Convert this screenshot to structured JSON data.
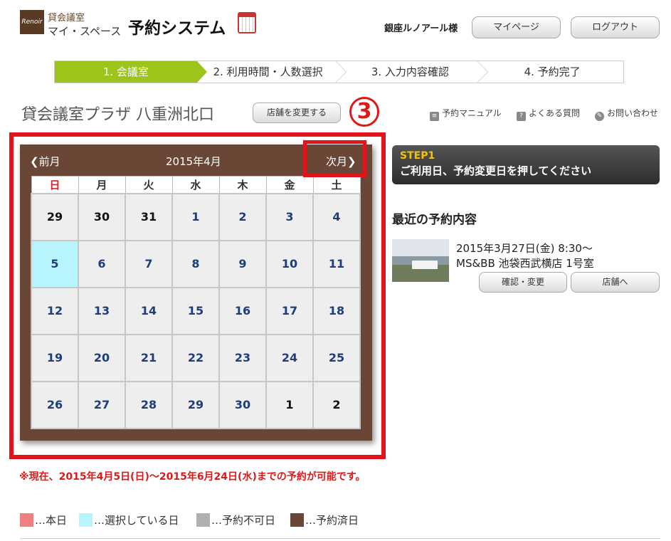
{
  "header": {
    "logo_text": "Renoir",
    "logo_sub1": "貸会議室",
    "logo_sub2": "マイ・スペース",
    "app_title": "予約システム",
    "user_name": "銀座ルノアール様",
    "mypage_label": "マイページ",
    "logout_label": "ログアウト"
  },
  "steps": [
    {
      "label": "1. 会議室",
      "active": true
    },
    {
      "label": "2. 利用時間・人数選択",
      "active": false
    },
    {
      "label": "3. 入力内容確認",
      "active": false
    },
    {
      "label": "4. 予約完了",
      "active": false
    }
  ],
  "store": {
    "name": "貸会議室プラザ 八重洲北口",
    "change_label": "店舗を変更する",
    "marker": "3"
  },
  "links": {
    "manual": "予約マニュアル",
    "faq": "よくある質問",
    "contact": "お問い合わせ"
  },
  "calendar": {
    "prev_label": "前月",
    "month_label": "2015年4月",
    "next_label": "次月",
    "weekdays": [
      "日",
      "月",
      "火",
      "水",
      "木",
      "金",
      "土"
    ],
    "weeks": [
      [
        {
          "d": "29",
          "other": true
        },
        {
          "d": "30",
          "other": true
        },
        {
          "d": "31",
          "other": true
        },
        {
          "d": "1"
        },
        {
          "d": "2"
        },
        {
          "d": "3"
        },
        {
          "d": "4"
        }
      ],
      [
        {
          "d": "5",
          "selected": true
        },
        {
          "d": "6"
        },
        {
          "d": "7"
        },
        {
          "d": "8"
        },
        {
          "d": "9"
        },
        {
          "d": "10"
        },
        {
          "d": "11"
        }
      ],
      [
        {
          "d": "12"
        },
        {
          "d": "13"
        },
        {
          "d": "14"
        },
        {
          "d": "15"
        },
        {
          "d": "16"
        },
        {
          "d": "17"
        },
        {
          "d": "18"
        }
      ],
      [
        {
          "d": "19"
        },
        {
          "d": "20"
        },
        {
          "d": "21"
        },
        {
          "d": "22"
        },
        {
          "d": "23"
        },
        {
          "d": "24"
        },
        {
          "d": "25"
        }
      ],
      [
        {
          "d": "26"
        },
        {
          "d": "27"
        },
        {
          "d": "28"
        },
        {
          "d": "29"
        },
        {
          "d": "30"
        },
        {
          "d": "1",
          "other": true
        },
        {
          "d": "2",
          "other": true
        }
      ]
    ]
  },
  "step_banner": {
    "label": "STEP1",
    "text": "ご利用日、予約変更日を押してください"
  },
  "recent": {
    "title": "最近の予約内容",
    "line1": "2015年3月27日(金) 8:30～",
    "line2": "MS&BB 池袋西武横店 1号室",
    "confirm_label": "確認・変更",
    "store_label": "店舗へ"
  },
  "notice": "※現在、2015年4月5日(日)～2015年6月24日(水)までの予約が可能です。",
  "legend": [
    {
      "label": "…本日",
      "color": "#f08080"
    },
    {
      "label": "…選択している日",
      "color": "#b8f4fb"
    },
    {
      "label": "…予約不可日",
      "color": "#b0b0b0"
    },
    {
      "label": "…予約済日",
      "color": "#6a4637"
    }
  ]
}
